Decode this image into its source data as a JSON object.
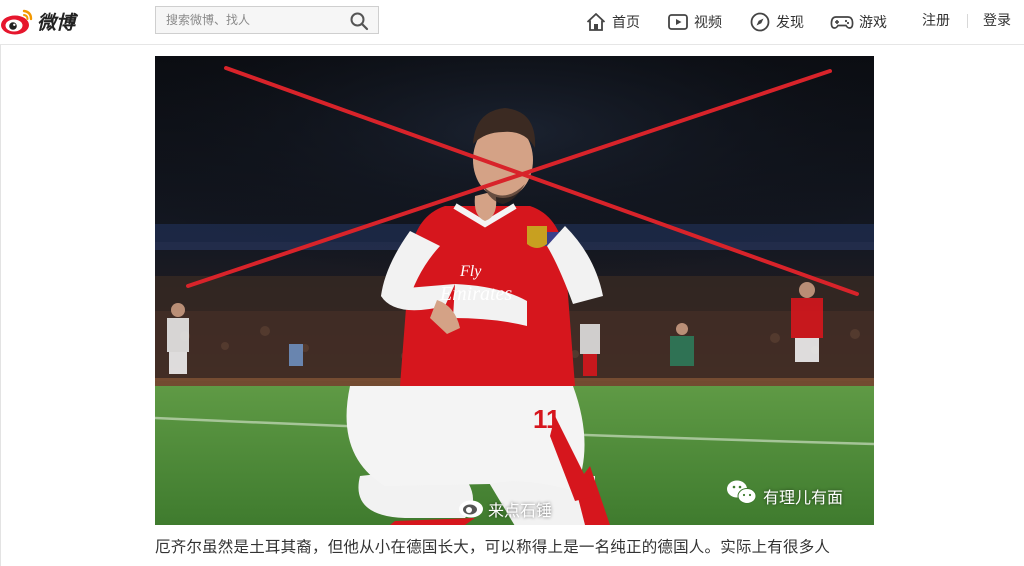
{
  "header": {
    "brand": "微博",
    "search": {
      "placeholder": "搜索微博、找人",
      "value": ""
    },
    "nav": [
      {
        "label": "首页",
        "icon": "home-icon"
      },
      {
        "label": "视频",
        "icon": "video-icon"
      },
      {
        "label": "发现",
        "icon": "compass-icon"
      },
      {
        "label": "游戏",
        "icon": "gamepad-icon"
      }
    ],
    "register_label": "注册",
    "login_label": "登录"
  },
  "article": {
    "image": {
      "subject": "football-player-kneeling-celebration",
      "watermark_center": "来点石锤",
      "watermark_right": "有理儿有面",
      "shirt_sponsor": "Fly Emirates",
      "shirt_number": "11"
    },
    "paragraph": "厄齐尔虽然是土耳其裔，但他从小在德国长大，可以称得上是一名纯正的德国人。实际上有很多人"
  },
  "colors": {
    "accent": "#e6162d",
    "cross_line": "#d8232a",
    "pitch": "#4f8e3a",
    "kit_red": "#d6161d"
  }
}
